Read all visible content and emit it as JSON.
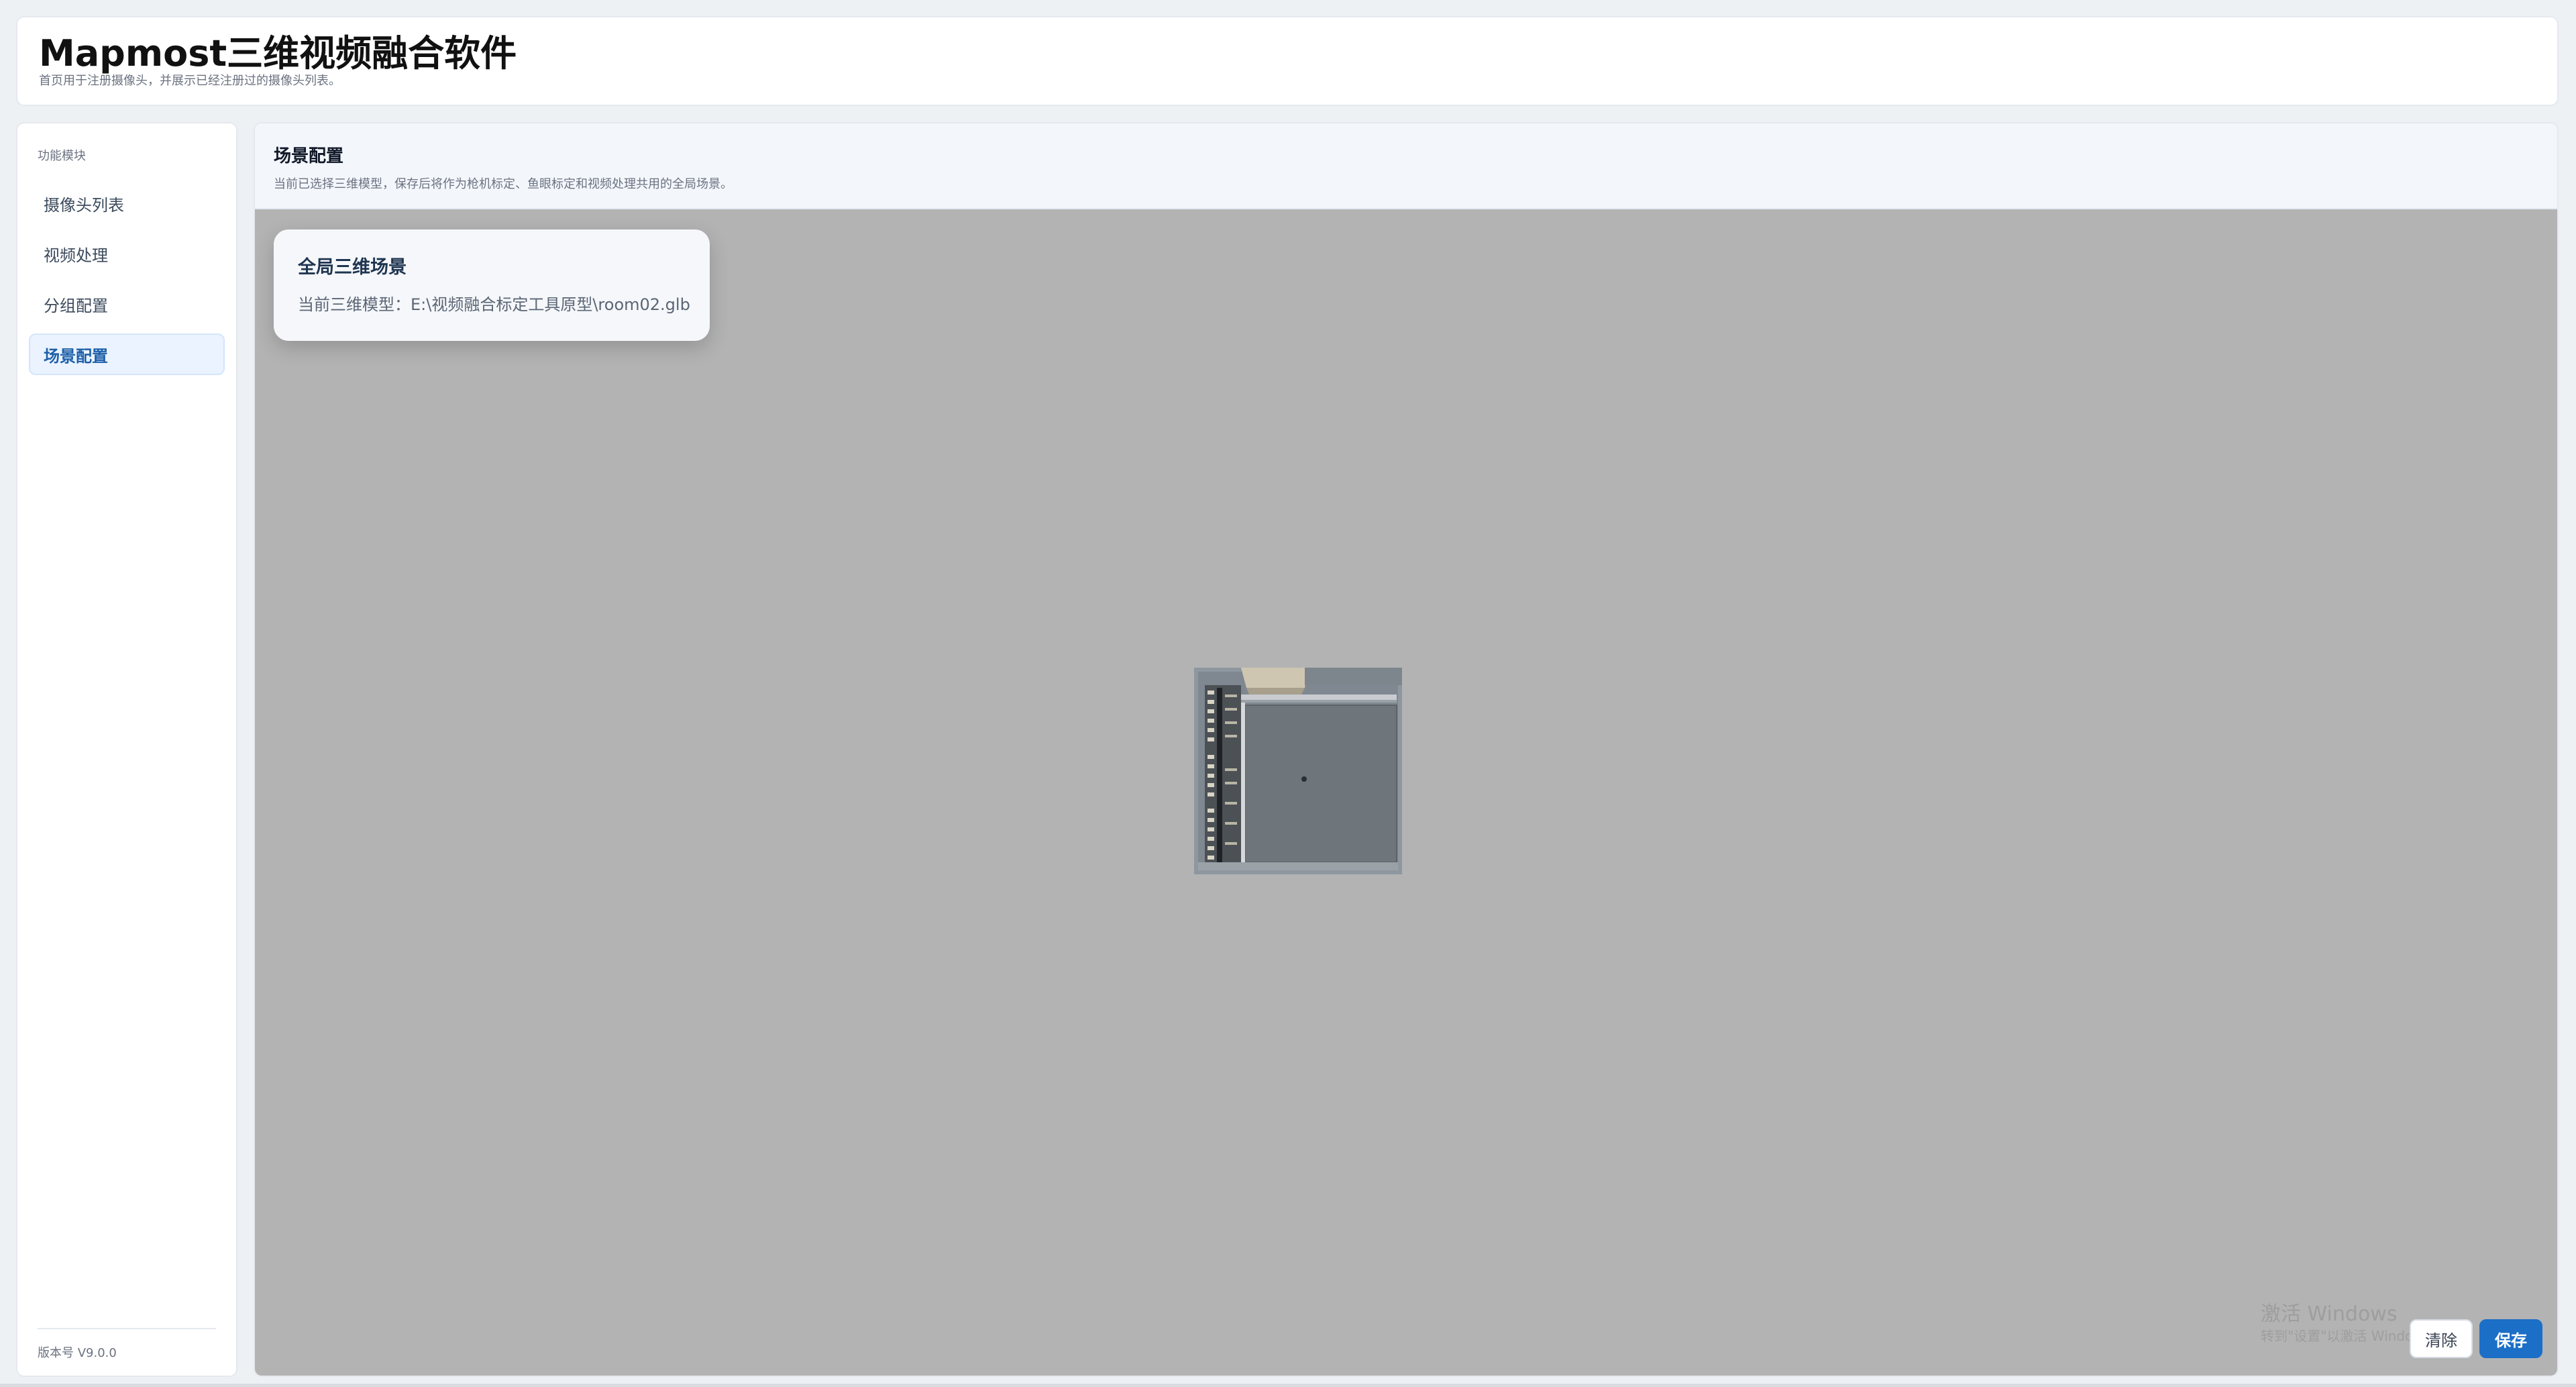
{
  "header": {
    "title": "Mapmost三维视频融合软件",
    "subtitle": "首页用于注册摄像头，并展示已经注册过的摄像头列表。"
  },
  "sidebar": {
    "section_title": "功能模块",
    "items": [
      {
        "label": "摄像头列表",
        "active": false
      },
      {
        "label": "视频处理",
        "active": false
      },
      {
        "label": "分组配置",
        "active": false
      },
      {
        "label": "场景配置",
        "active": true
      }
    ],
    "version": "版本号 V9.0.0"
  },
  "main": {
    "title": "场景配置",
    "description": "当前已选择三维模型，保存后将作为枪机标定、鱼眼标定和视频处理共用的全局场景。",
    "scene_card": {
      "title": "全局三维场景",
      "model_label": "当前三维模型：E:\\视频融合标定工具原型\\room02.glb"
    },
    "viewport_background": "#b3b3b3",
    "buttons": {
      "clear_label": "清除",
      "save_label": "保存"
    }
  },
  "watermark": {
    "line1": "激活 Windows",
    "line2": "转到\"设置\"以激活 Windows。"
  },
  "colors": {
    "accent": "#1b6fc7",
    "active_nav_bg": "#eaf3ff",
    "active_nav_text": "#1d5fa8"
  }
}
